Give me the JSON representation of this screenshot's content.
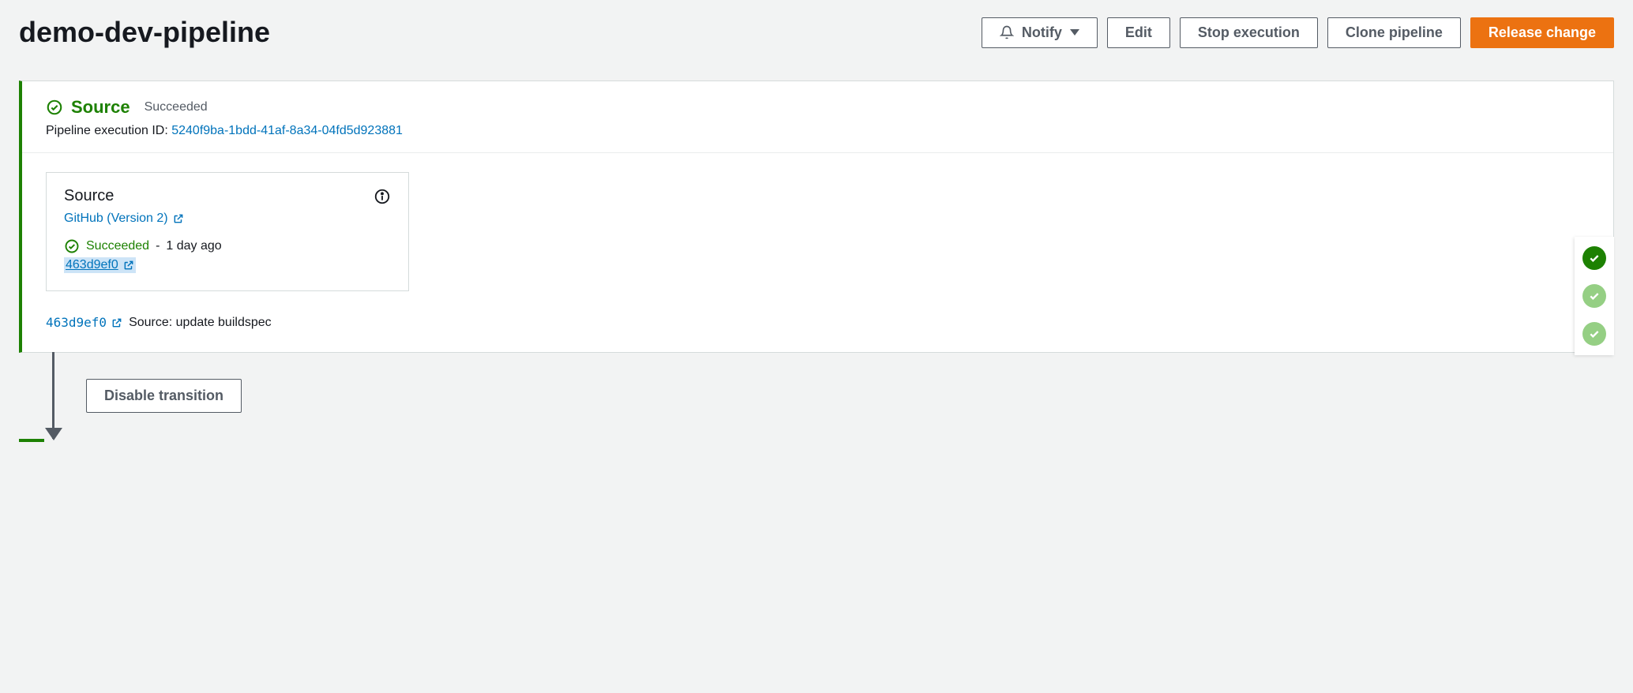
{
  "header": {
    "title": "demo-dev-pipeline",
    "notify": "Notify",
    "edit": "Edit",
    "stop": "Stop execution",
    "clone": "Clone pipeline",
    "release": "Release change"
  },
  "stage": {
    "name": "Source",
    "status": "Succeeded",
    "exec_label": "Pipeline execution ID:",
    "exec_id": "5240f9ba-1bdd-41af-8a34-04fd5d923881",
    "action": {
      "title": "Source",
      "provider": "GitHub (Version 2)",
      "status": "Succeeded",
      "time": "1 day ago",
      "commit": "463d9ef0"
    },
    "commit_summary": {
      "commit": "463d9ef0",
      "message": "Source: update buildspec"
    }
  },
  "transition": {
    "disable": "Disable transition"
  }
}
